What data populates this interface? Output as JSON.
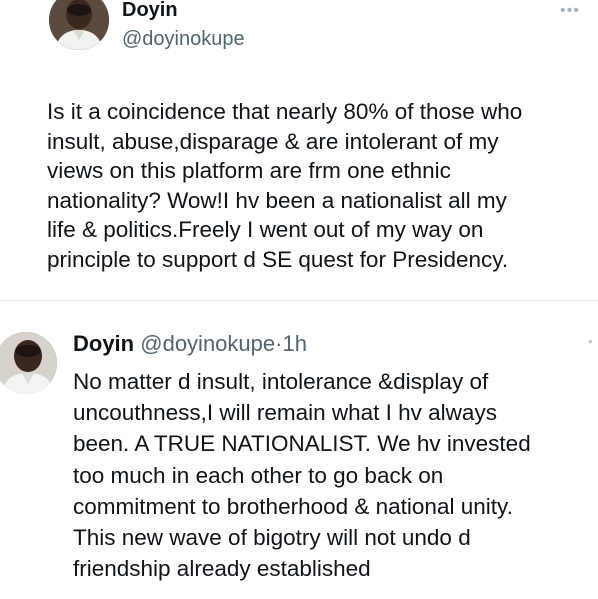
{
  "tweet1": {
    "display_name": "Doyin",
    "handle": "@doyinokupe",
    "more_icon": "•••",
    "text": "Is it a coincidence that nearly 80% of those who\ninsult, abuse,disparage & are intolerant of my\nviews on this platform are frm one ethnic\nnationality? Wow!I hv been a nationalist all my\nlife & politics.Freely I went out of my way on\nprinciple to support d SE quest for Presidency."
  },
  "tweet2": {
    "display_name": "Doyin",
    "handle": "@doyinokupe",
    "separator": "·",
    "time": "1h",
    "more_icon": "•",
    "text": "No matter d insult, intolerance &display of\nuncouthness,I will remain what I hv always\nbeen. A TRUE NATIONALIST. We hv invested\ntoo much in each other to go back on\ncommitment to brotherhood & national unity.\nThis new wave of bigotry will not undo d\nfriendship already established"
  }
}
